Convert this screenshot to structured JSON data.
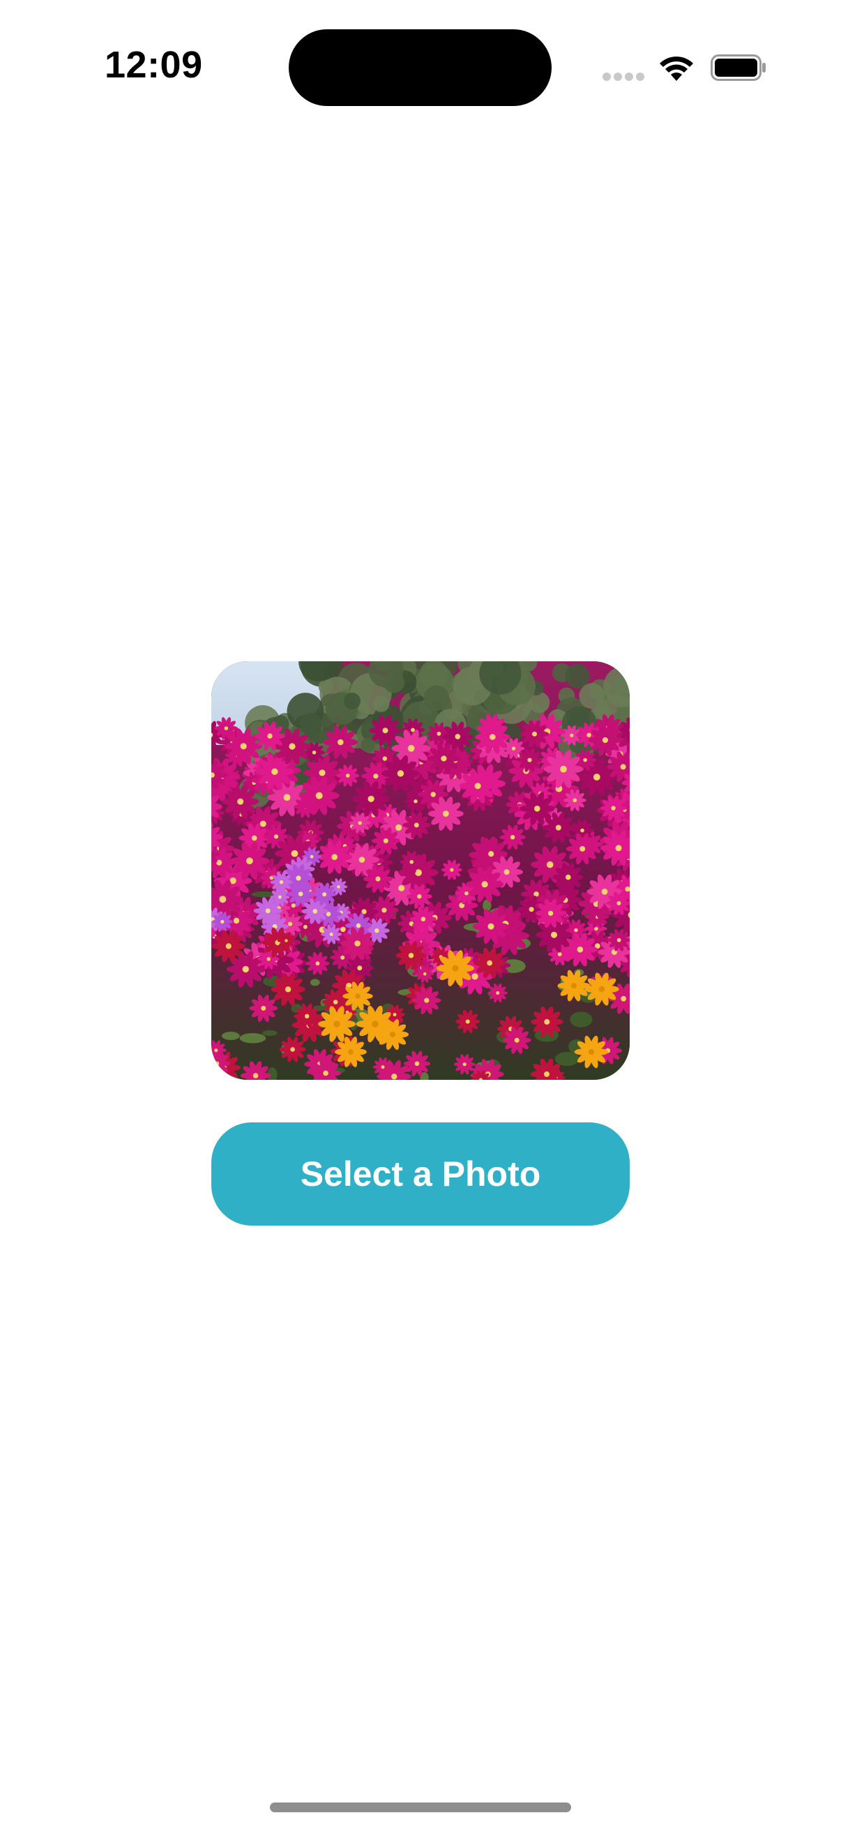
{
  "status_bar": {
    "time": "12:09",
    "icons": [
      "cellular-signal-icon",
      "wifi-icon",
      "battery-icon"
    ]
  },
  "photo": {
    "subject": "field of magenta, purple and orange ice plant flowers with shrubs behind"
  },
  "button": {
    "label": "Select a Photo",
    "color": "#30b0c7",
    "text_color": "#ffffff"
  }
}
